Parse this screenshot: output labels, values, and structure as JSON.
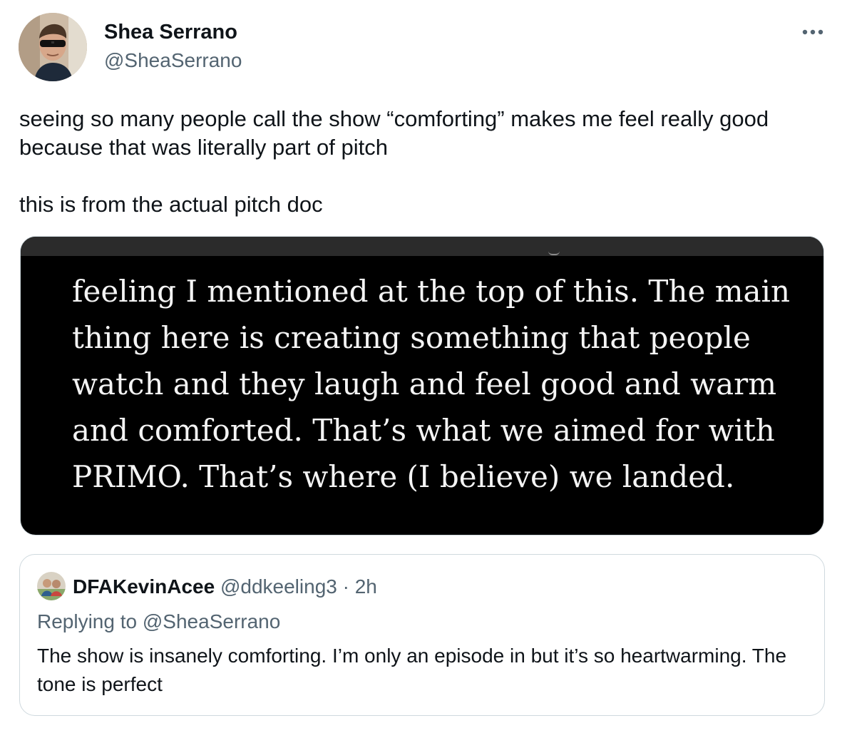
{
  "author": {
    "name": "Shea Serrano",
    "handle": "@SheaSerrano"
  },
  "tweet": {
    "paragraph_1": "seeing so many people call the show “comforting” makes me feel really good because that was literally part of pitch",
    "paragraph_2": "this is from the actual pitch doc"
  },
  "media": {
    "lines": [
      "feeling I mentioned at the top of this. The main",
      "thing here is creating something that people",
      "watch and they laugh and feel good and warm",
      "and comforted. That’s what we aimed for with",
      "PRIMO. That’s where (I believe) we landed."
    ]
  },
  "quote": {
    "name": "DFAKevinAcee",
    "handle": "@ddkeeling3",
    "separator": " · ",
    "time": "2h",
    "replying_label": "Replying to ",
    "replying_mention": "@SheaSerrano",
    "body": "The show is insanely comforting. I’m only an episode in but it’s so heartwarming. The tone is perfect"
  },
  "icons": {
    "more": "more-horizontal-icon"
  },
  "colors": {
    "text_primary": "#0f1419",
    "text_secondary": "#536471",
    "border": "#cfd9de",
    "media_background": "#000000"
  }
}
